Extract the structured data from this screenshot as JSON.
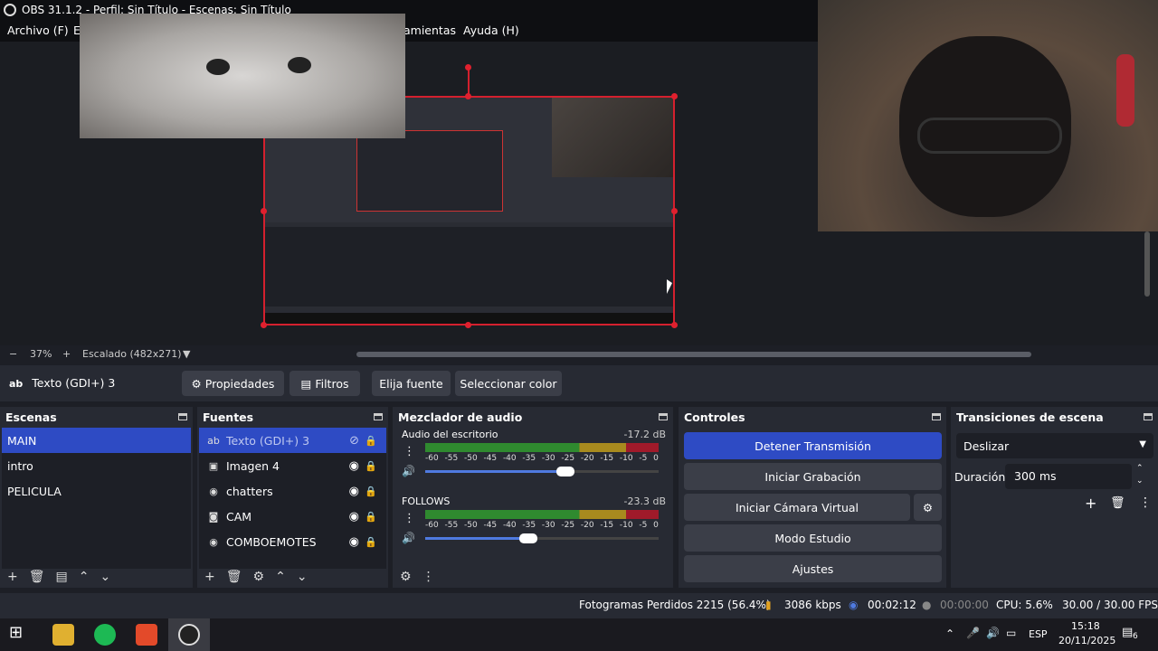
{
  "window": {
    "title": "OBS 31.1.2 - Perfil: Sin Título - Escenas: Sin Título"
  },
  "menu": [
    "Archivo (F)",
    "E",
    "amientas",
    "Ayuda (H)"
  ],
  "zoom": {
    "minus": "−",
    "percent": "37%",
    "plus": "+",
    "scaling": "Escalado (482x271)",
    "dropdown": "▼"
  },
  "source_toolbar": {
    "source_icon": "ab",
    "source_name": "Texto (GDI+) 3",
    "properties": "Propiedades",
    "filters": "Filtros",
    "choose_font": "Elija fuente",
    "choose_color": "Seleccionar color"
  },
  "scenes": {
    "title": "Escenas",
    "items": [
      "MAIN",
      "intro",
      "PELICULA"
    ],
    "selected": "MAIN"
  },
  "sources": {
    "title": "Fuentes",
    "items": [
      {
        "name": "Texto (GDI+) 3",
        "icon": "text-icon",
        "glyph": "ab"
      },
      {
        "name": "Imagen 4",
        "icon": "image-icon",
        "glyph": "▣"
      },
      {
        "name": "chatters",
        "icon": "browser-icon",
        "glyph": "◉"
      },
      {
        "name": "CAM",
        "icon": "camera-icon",
        "glyph": "◙"
      },
      {
        "name": "COMBOEMOTES",
        "icon": "browser-icon",
        "glyph": "◉"
      }
    ]
  },
  "mixer": {
    "title": "Mezclador de audio",
    "ticks": [
      "-60",
      "-55",
      "-50",
      "-45",
      "-40",
      "-35",
      "-30",
      "-25",
      "-20",
      "-15",
      "-10",
      "-5",
      "0"
    ],
    "channels": [
      {
        "name": "Audio del escritorio",
        "db": "-17.2 dB",
        "volume": 0.6
      },
      {
        "name": "FOLLOWS",
        "db": "-23.3 dB",
        "volume": 0.44
      }
    ]
  },
  "controls": {
    "title": "Controles",
    "stop_stream": "Detener Transmisión",
    "start_recording": "Iniciar Grabación",
    "start_virtual_cam": "Iniciar Cámara Virtual",
    "studio_mode": "Modo Estudio",
    "settings": "Ajustes"
  },
  "transitions": {
    "title": "Transiciones de escena",
    "selected": "Deslizar",
    "duration_label": "Duración",
    "duration_value": "300 ms"
  },
  "status": {
    "dropped_frames": "Fotogramas Perdidos 2215 (56.4%)",
    "bitrate": "3086 kbps",
    "stream_time": "00:02:12",
    "record_time": "00:00:00",
    "cpu": "CPU: 5.6%",
    "fps": "30.00 / 30.00 FPS"
  },
  "taskbar": {
    "lang": "ESP",
    "time": "15:18",
    "date": "20/11/2025",
    "notifications": "6"
  },
  "colors": {
    "accent": "#2e4bc4",
    "selection_red": "#d4202e",
    "dock_bg": "#272a33",
    "panel_bg": "#1d1f26"
  }
}
